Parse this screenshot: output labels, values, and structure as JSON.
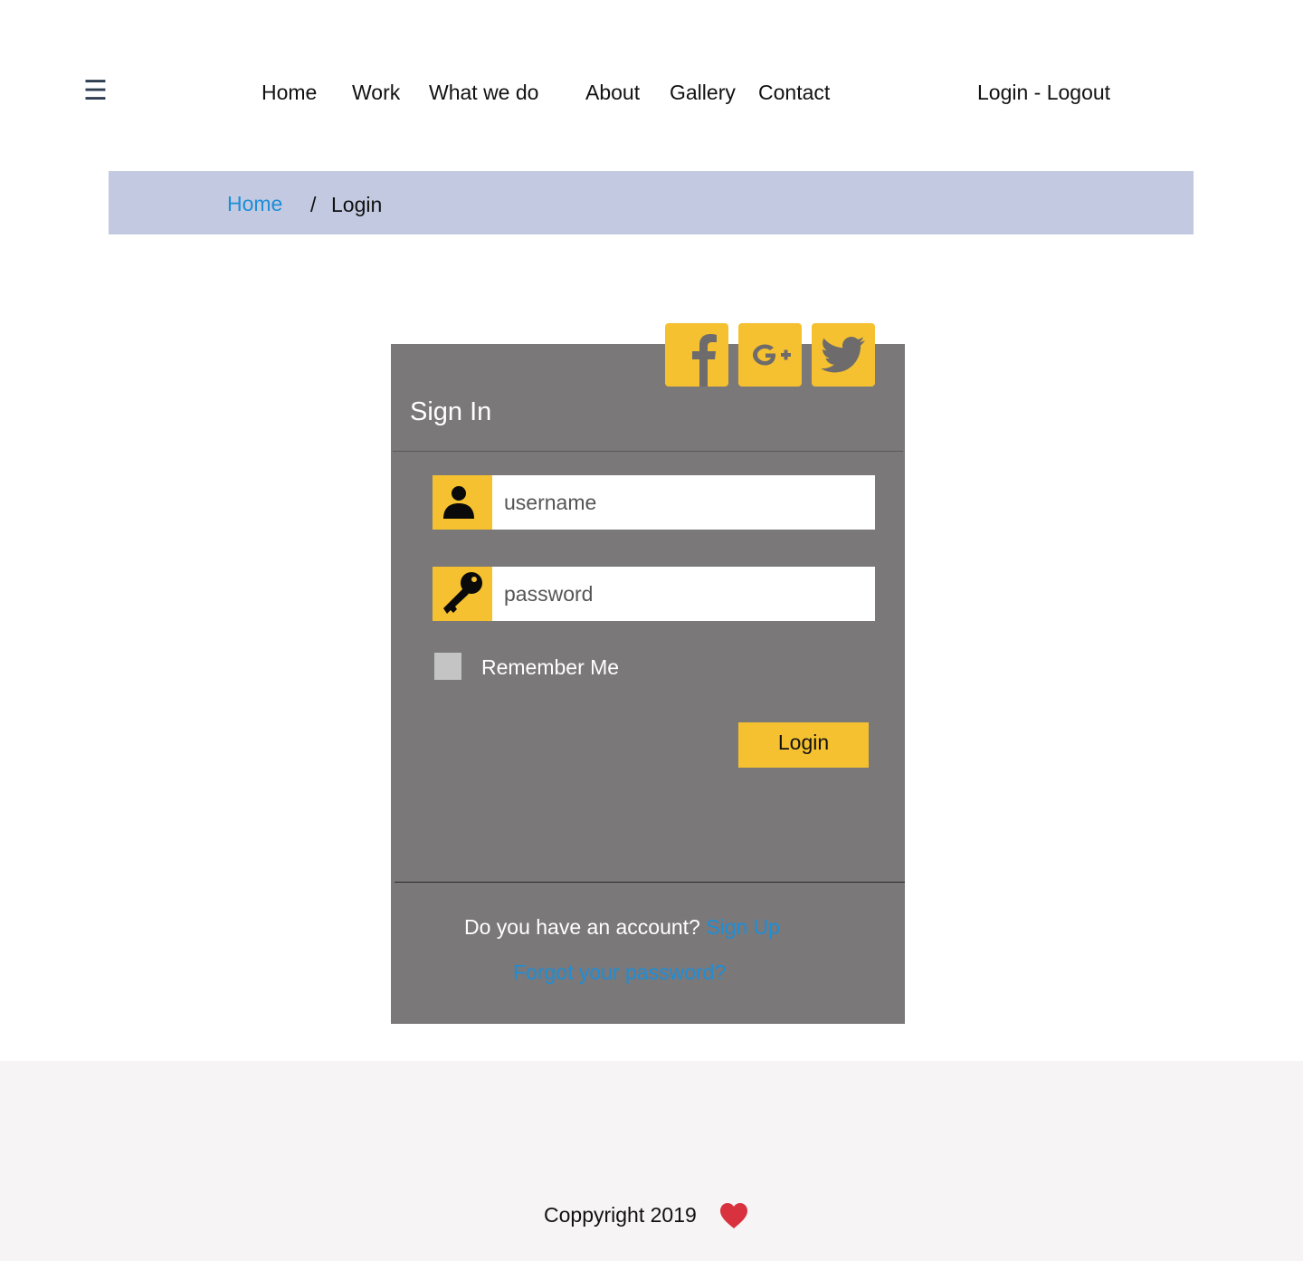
{
  "nav": {
    "menu_glyph": "☰",
    "links": [
      "Home",
      "Work",
      "What we do",
      "About",
      "Gallery",
      "Contact"
    ],
    "auth": "Login - Logout"
  },
  "breadcrumb": {
    "home": "Home",
    "separator": "/",
    "current": "Login"
  },
  "card": {
    "title": "Sign In",
    "social": [
      "facebook-icon",
      "google-plus-icon",
      "twitter-icon"
    ],
    "username_placeholder": "username",
    "password_placeholder": "password",
    "remember_label": "Remember Me",
    "login_label": "Login",
    "account_question": "Do you have an account?",
    "signup_label": "Sign Up",
    "forgot_label": "Forgot your password?"
  },
  "footer": {
    "copyright": "Coppyright 2019"
  },
  "colors": {
    "accent": "#f5c130",
    "card_bg": "#7a7879",
    "breadcrumb_bg": "#c2c9e0",
    "link": "#1d8ed8",
    "footer_bg": "#f6f4f5",
    "heart": "#d8323f"
  }
}
